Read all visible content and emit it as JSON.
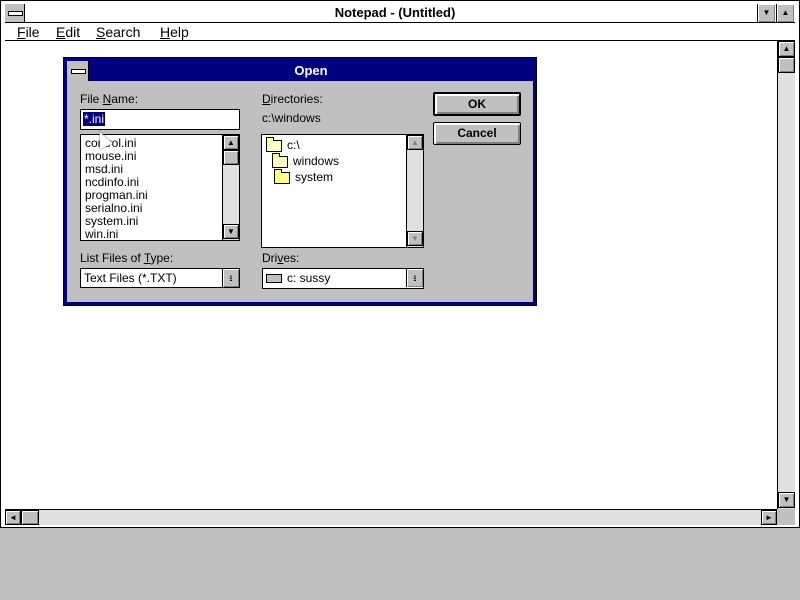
{
  "window": {
    "title": "Notepad - (Untitled)",
    "menu": [
      {
        "mnemonic": "F",
        "rest": "ile"
      },
      {
        "mnemonic": "E",
        "rest": "dit"
      },
      {
        "mnemonic": "S",
        "rest": "earch"
      },
      {
        "mnemonic": "H",
        "rest": "elp"
      }
    ],
    "minimize_glyph": "▼",
    "maximize_glyph": "▲"
  },
  "scrollbars": {
    "up": "▲",
    "down": "▼",
    "left": "◄",
    "right": "►"
  },
  "dialog": {
    "title": "Open",
    "file_name_label": {
      "before": "File ",
      "mnemonic": "N",
      "after": "ame:"
    },
    "file_name_value": "*.ini",
    "files": [
      "control.ini",
      "mouse.ini",
      "msd.ini",
      "ncdinfo.ini",
      "progman.ini",
      "serialno.ini",
      "system.ini",
      "win.ini"
    ],
    "directories_label": {
      "before": "",
      "mnemonic": "D",
      "after": "irectories:"
    },
    "current_directory": "c:\\windows",
    "directory_tree": [
      "c:\\",
      "windows",
      "system"
    ],
    "list_type_label": {
      "before": "List Files of ",
      "mnemonic": "T",
      "after": "ype:"
    },
    "list_type_value": "Text Files (*.TXT)",
    "drives_label": {
      "before": "Dri",
      "mnemonic": "v",
      "after": "es:"
    },
    "drive_value": "c: sussy",
    "ok_label": "OK",
    "cancel_label": "Cancel",
    "combo_arrow": "⭳"
  },
  "colors": {
    "title_active": "#000080",
    "face": "#c0c0c0",
    "selection": "#000080"
  }
}
